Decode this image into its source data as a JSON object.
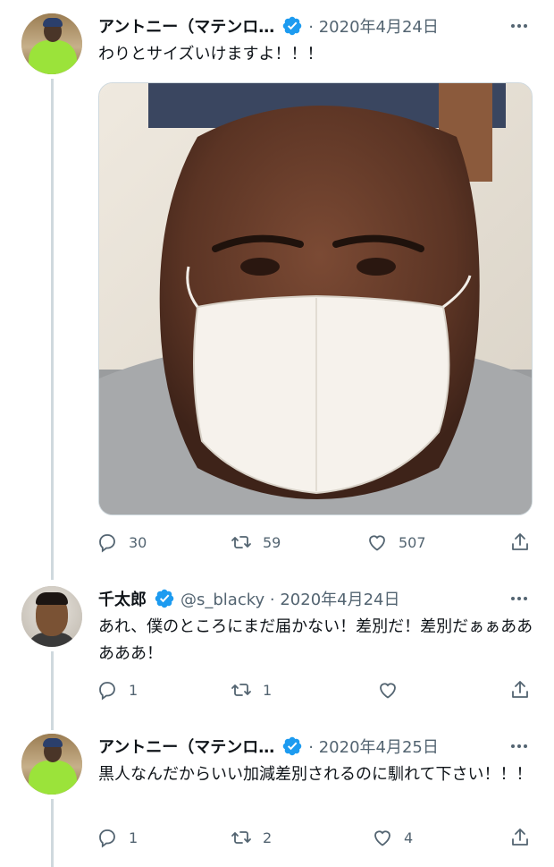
{
  "tweets": [
    {
      "display_name": "アントニー（マテンロ…",
      "meta": "· 2020年4月24日",
      "text": "わりとサイズいけますよ！！！",
      "avatar_icon": "avatar-anthony",
      "media": "mask-selfie-photo",
      "replies": "30",
      "retweets": "59",
      "likes": "507"
    },
    {
      "display_name": "千太郎",
      "meta": "@s_blacky · 2020年4月24日",
      "text": "あれ、僕のところにまだ届かない！差別だ！差別だぁぁあああああ！",
      "avatar_icon": "avatar-sentaro",
      "replies": "1",
      "retweets": "1",
      "likes": ""
    },
    {
      "display_name": "アントニー（マテンロ…",
      "meta": "· 2020年4月25日",
      "text": "黒人なんだからいい加減差別されるのに馴れて下さい！！！",
      "avatar_icon": "avatar-anthony",
      "replies": "1",
      "retweets": "2",
      "likes": "4"
    }
  ],
  "colors": {
    "verified": "#1d9bf0",
    "secondary_text": "#536471",
    "thread_line": "#cfd9de"
  }
}
